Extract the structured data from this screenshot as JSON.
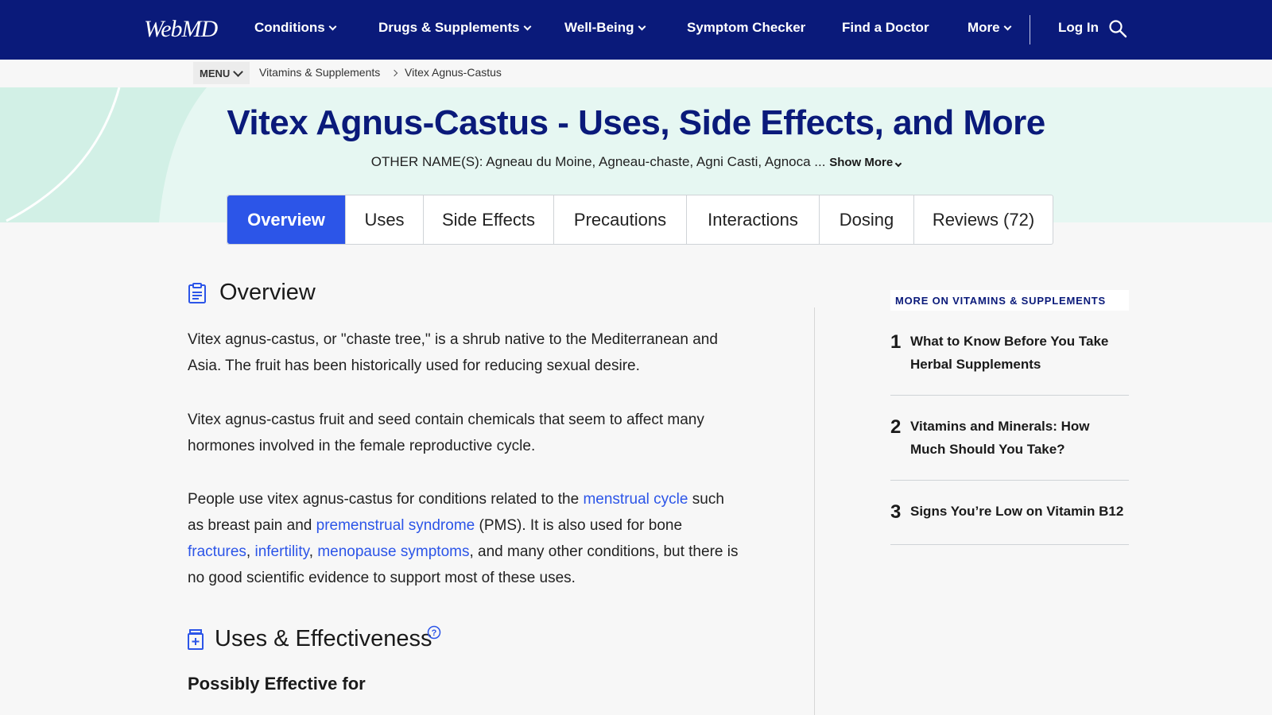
{
  "nav": {
    "logo": "WebMD",
    "items": [
      {
        "label": "Conditions"
      },
      {
        "label": "Drugs & Supplements"
      },
      {
        "label": "Well-Being"
      },
      {
        "label": "Symptom Checker"
      },
      {
        "label": "Find a Doctor"
      },
      {
        "label": "More"
      }
    ],
    "login": "Log In"
  },
  "breadcrumb": {
    "menu": "MENU",
    "items": [
      "Vitamins & Supplements",
      "Vitex Agnus-Castus"
    ]
  },
  "hero": {
    "title": "Vitex Agnus-Castus - Uses, Side Effects, and More",
    "other_names": "OTHER NAME(S): Agneau du Moine, Agneau-chaste, Agni Casti, Agnoca ...",
    "show_more": "Show More"
  },
  "tabs": [
    {
      "label": "Overview",
      "active": true
    },
    {
      "label": "Uses"
    },
    {
      "label": "Side Effects"
    },
    {
      "label": "Precautions"
    },
    {
      "label": "Interactions"
    },
    {
      "label": "Dosing"
    },
    {
      "label": "Reviews (72)"
    }
  ],
  "overview": {
    "heading": "Overview",
    "p1": "Vitex agnus-castus, or \"chaste tree,\" is a shrub native to the Mediterranean and Asia. The fruit has been historically used for reducing sexual desire.",
    "p2": "Vitex agnus-castus fruit and seed contain chemicals that seem to affect many hormones involved in the female reproductive cycle.",
    "p3": {
      "t1": "People use vitex agnus-castus for conditions related to the ",
      "l1": "menstrual cycle",
      "t2": " such as breast pain and ",
      "l2": "premenstrual syndrome",
      "t3": " (PMS). It is also used for bone ",
      "l3": "fractures",
      "t4": ", ",
      "l4": "infertility",
      "t5": ", ",
      "l5": "menopause symptoms",
      "t6": ", and many other conditions, but there is no good scientific evidence to support most of these uses."
    }
  },
  "uses": {
    "heading": "Uses & Effectiveness",
    "subheading": "Possibly Effective for"
  },
  "sidebar": {
    "label": "MORE ON VITAMINS & SUPPLEMENTS",
    "items": [
      {
        "num": "1",
        "text": "What to Know Before You Take Herbal Supplements"
      },
      {
        "num": "2",
        "text": "Vitamins and Minerals: How Much Should You Take?"
      },
      {
        "num": "3",
        "text": "Signs You’re Low on Vitamin B12"
      }
    ]
  },
  "colors": {
    "nav_bg": "#0a1a7a",
    "accent": "#2c55e8",
    "hero_bg": "#e6f7f2"
  }
}
